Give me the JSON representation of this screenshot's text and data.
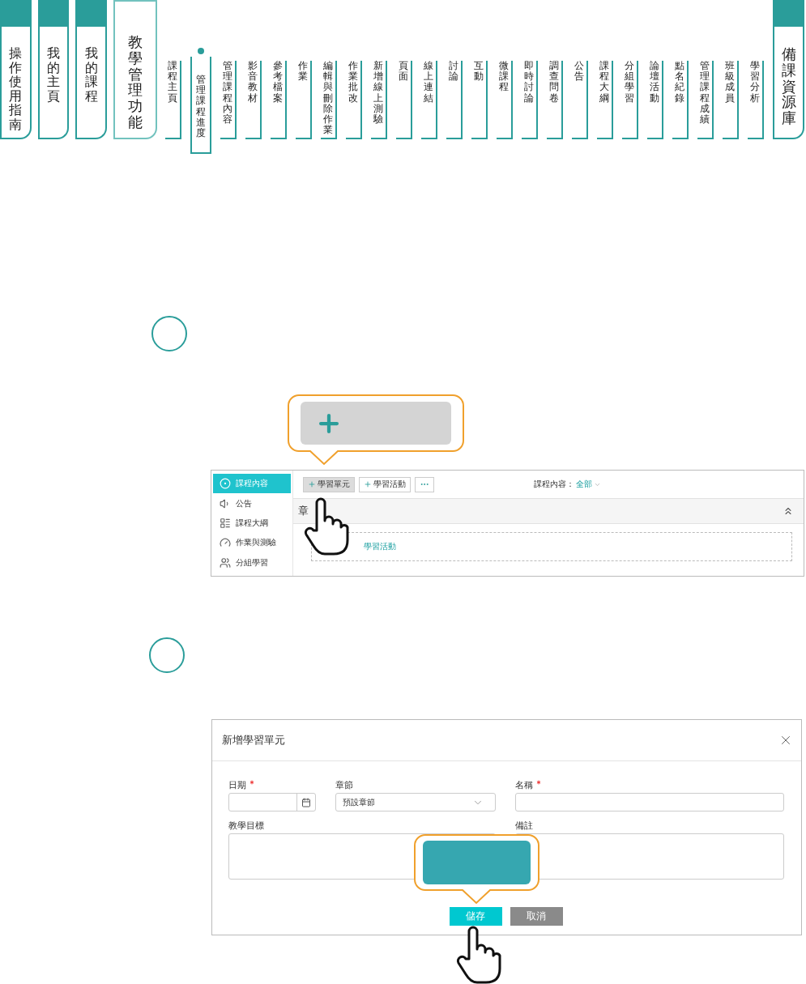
{
  "nav": {
    "main_tabs": [
      {
        "label": "操作使用指南",
        "selected": false
      },
      {
        "label": "我的主頁",
        "selected": false
      },
      {
        "label": "我的課程",
        "selected": false
      },
      {
        "label": "教學管理功能",
        "selected": true
      }
    ],
    "sub_tabs": [
      {
        "label": "課程主頁",
        "selected": false
      },
      {
        "label": "管理課程進度",
        "selected": true
      },
      {
        "label": "管理課程內容",
        "selected": false
      },
      {
        "label": "影音教材",
        "selected": false
      },
      {
        "label": "參考檔案",
        "selected": false
      },
      {
        "label": "作業",
        "selected": false
      },
      {
        "label": "編輯與刪除作業",
        "selected": false
      },
      {
        "label": "作業批改",
        "selected": false
      },
      {
        "label": "新增線上測驗",
        "selected": false
      },
      {
        "label": "頁面",
        "selected": false
      },
      {
        "label": "線上連結",
        "selected": false
      },
      {
        "label": "討論",
        "selected": false
      },
      {
        "label": "互動",
        "selected": false
      },
      {
        "label": "微課程",
        "selected": false
      },
      {
        "label": "即時討論",
        "selected": false
      },
      {
        "label": "調查問卷",
        "selected": false
      },
      {
        "label": "公告",
        "selected": false
      },
      {
        "label": "課程大綱",
        "selected": false
      },
      {
        "label": "分組學習",
        "selected": false
      },
      {
        "label": "論壇活動",
        "selected": false
      },
      {
        "label": "點名紀錄",
        "selected": false
      },
      {
        "label": "管理課程成績",
        "selected": false
      },
      {
        "label": "班級成員",
        "selected": false
      },
      {
        "label": "學習分析",
        "selected": false
      }
    ],
    "resource_tab": {
      "label": "備課資源庫"
    }
  },
  "course_screen": {
    "sidebar": [
      {
        "label": "課程內容",
        "selected": true
      },
      {
        "label": "公告",
        "selected": false
      },
      {
        "label": "課程大綱",
        "selected": false
      },
      {
        "label": "作業與測驗",
        "selected": false
      },
      {
        "label": "分組學習",
        "selected": false
      }
    ],
    "toolbar": {
      "buttons": [
        {
          "label": "學習單元",
          "pressed": true
        },
        {
          "label": "學習活動",
          "pressed": false
        }
      ],
      "filter_label": "課程內容：",
      "filter_value": "全部"
    },
    "section_title": "章",
    "activity_link": "學習活動"
  },
  "dialog": {
    "title": "新增學習單元",
    "fields": [
      {
        "label": "日期",
        "required": true,
        "kind": "date"
      },
      {
        "label": "章節",
        "required": false,
        "kind": "select",
        "value": "預設章節"
      },
      {
        "label": "名稱",
        "required": true,
        "kind": "text"
      },
      {
        "label": "教學目標",
        "required": false,
        "kind": "textarea"
      },
      {
        "label": "備註",
        "required": false,
        "kind": "textarea"
      }
    ],
    "buttons": [
      {
        "label": "儲存",
        "kind": "primary"
      },
      {
        "label": "取消",
        "kind": "secondary"
      }
    ]
  }
}
